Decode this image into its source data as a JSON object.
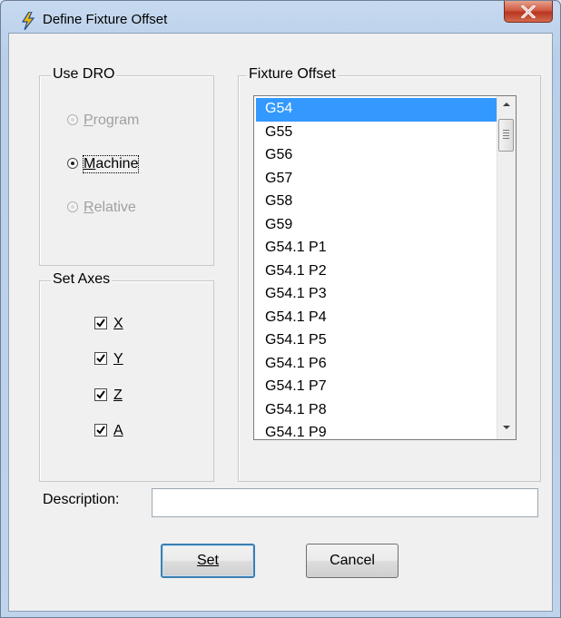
{
  "window": {
    "title": "Define Fixture Offset"
  },
  "use_dro": {
    "legend": "Use DRO",
    "options": [
      {
        "label": "Program",
        "selected": false,
        "enabled": false
      },
      {
        "label": "Machine",
        "selected": true,
        "enabled": true
      },
      {
        "label": "Relative",
        "selected": false,
        "enabled": false
      }
    ]
  },
  "set_axes": {
    "legend": "Set Axes",
    "axes": [
      {
        "label": "X",
        "checked": true
      },
      {
        "label": "Y",
        "checked": true
      },
      {
        "label": "Z",
        "checked": true
      },
      {
        "label": "A",
        "checked": true
      }
    ]
  },
  "fixture_offset": {
    "legend": "Fixture Offset",
    "selected": "G54",
    "items": [
      "G54",
      "G55",
      "G56",
      "G57",
      "G58",
      "G59",
      "G54.1 P1",
      "G54.1 P2",
      "G54.1 P3",
      "G54.1 P4",
      "G54.1 P5",
      "G54.1 P6",
      "G54.1 P7",
      "G54.1 P8",
      "G54.1 P9"
    ]
  },
  "description": {
    "label": "Description:",
    "value": ""
  },
  "buttons": {
    "set_label": "Set",
    "cancel_label": "Cancel"
  },
  "icons": {
    "app": "lightning-bolt-icon",
    "close": "close-icon",
    "check": "checkmark-icon"
  },
  "colors": {
    "selection": "#3399ff",
    "close_button": "#c9462f",
    "app_icon": "#f2b705"
  }
}
